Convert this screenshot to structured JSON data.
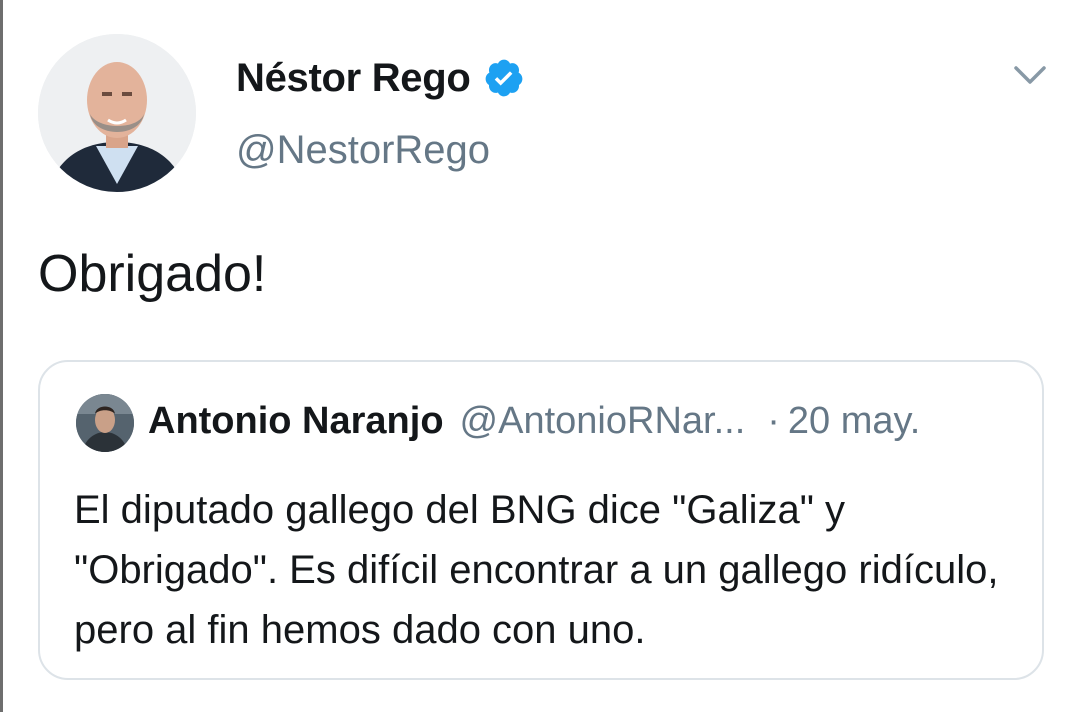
{
  "author": {
    "display_name": "Néstor Rego",
    "handle": "@NestorRego",
    "verified": true,
    "avatar_icon": "profile-photo"
  },
  "tweet": {
    "text": "Obrigado!"
  },
  "menu": {
    "icon": "chevron-down-icon"
  },
  "quoted_tweet": {
    "display_name": "Antonio Naranjo",
    "handle": "@AntonioRNar...",
    "separator": "·",
    "date": "20 may.",
    "text": "El diputado gallego del BNG dice \"Galiza\" y \"Obrigado\". Es difícil encontrar a un gallego ridículo, pero al fin hemos dado con uno."
  },
  "colors": {
    "verified_blue": "#1da1f2",
    "secondary_text": "#657786",
    "border": "#dde3e8"
  }
}
